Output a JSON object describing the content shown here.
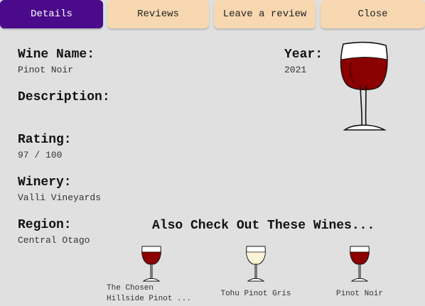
{
  "tabs": {
    "details": "Details",
    "reviews": "Reviews",
    "leave_review": "Leave a review",
    "close": "Close"
  },
  "colors": {
    "accent": "#4b0a8a",
    "tab_bg": "#f7d8b1",
    "background": "#e0e0e0",
    "red_wine": "#8b0000",
    "white_wine": "#fbf3d6"
  },
  "wine": {
    "name_label": "Wine Name:",
    "name": "Pinot Noir",
    "year_label": "Year:",
    "year": "2021",
    "description_label": "Description:",
    "description": "",
    "rating_label": "Rating:",
    "rating": "97 / 100",
    "winery_label": "Winery:",
    "winery": "Valli Vineyards",
    "region_label": "Region:",
    "region": "Central Otago",
    "image_icon": "red-wine-glass-icon"
  },
  "recommendations": {
    "title": "Also Check Out These Wines...",
    "items": [
      {
        "name": "The Chosen Hillside Pinot ...",
        "icon": "red-wine-glass-icon"
      },
      {
        "name": "Tohu Pinot Gris",
        "icon": "white-wine-glass-icon"
      },
      {
        "name": "Pinot Noir",
        "icon": "red-wine-glass-icon"
      }
    ]
  }
}
